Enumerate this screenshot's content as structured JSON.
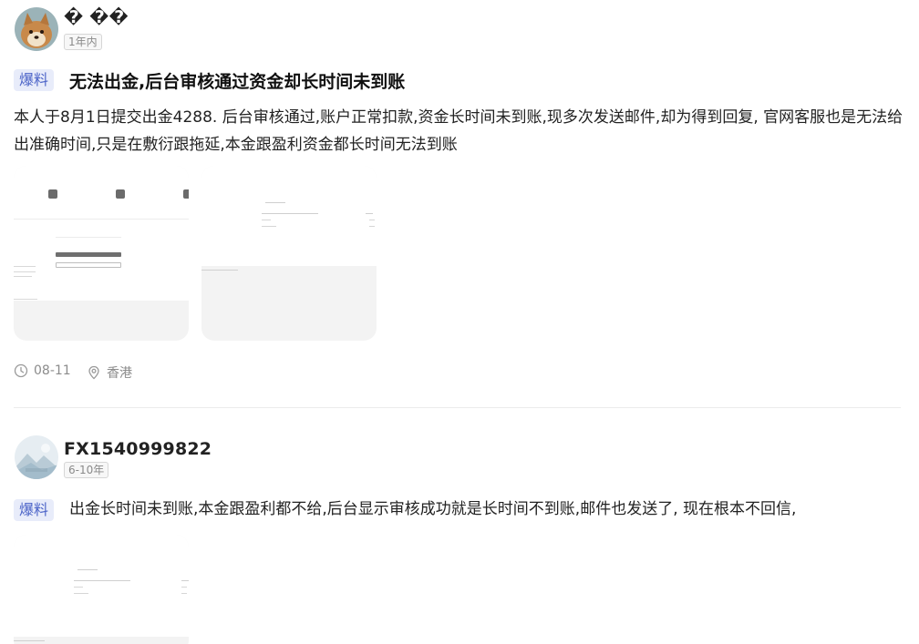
{
  "posts": [
    {
      "username": "� ��",
      "tenure": "1年内",
      "badge": "爆料",
      "title": "无法出金,后台审核通过资金却长时间未到账",
      "body": "本人于8月1日提交出金4288. 后台审核通过,账户正常扣款,资金长时间未到账,现多次发送邮件,却为得到回复, 官网客服也是无法给出准确时间,只是在敷衍跟拖延,本金跟盈利资金都长时间无法到账",
      "date": "08-11",
      "location": "香港"
    },
    {
      "username": "FX1540999822",
      "tenure": "6-10年",
      "badge": "爆料",
      "body": "出金长时间未到账,本金跟盈利都不给,后台显示审核成功就是长时间不到账,邮件也发送了, 现在根本不回信,"
    }
  ],
  "icons": {
    "date": "clock-icon",
    "location": "location-pin-icon"
  },
  "colors": {
    "badge_bg": "#e8ecfa",
    "badge_text": "#4c64c8",
    "meta_text": "#8c8c8c"
  }
}
